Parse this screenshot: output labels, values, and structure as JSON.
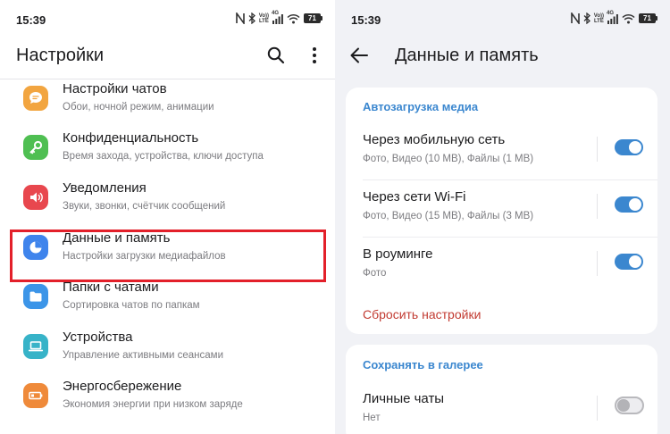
{
  "status_bar": {
    "time": "15:39",
    "network_label_top": "Vo))",
    "network_label_bottom": "LTE",
    "network_4g": "4G",
    "battery": "71"
  },
  "colors": {
    "accent": "#3b87cf",
    "highlight": "#e3202a",
    "reset_text": "#c23b32",
    "subtitle_text": "#7c7c80"
  },
  "left": {
    "title": "Настройки",
    "search_icon": "search-icon",
    "more_icon": "more-vertical-icon",
    "items": [
      {
        "title": "Настройки чатов",
        "subtitle": "Обои, ночной режим, анимации",
        "icon": "chat-bubble-icon",
        "color": "#f2a540"
      },
      {
        "title": "Конфиденциальность",
        "subtitle": "Время захода, устройства, ключи доступа",
        "icon": "key-icon",
        "color": "#4fbf52"
      },
      {
        "title": "Уведомления",
        "subtitle": "Звуки, звонки, счётчик сообщений",
        "icon": "speaker-icon",
        "color": "#e8474e"
      },
      {
        "title": "Данные и память",
        "subtitle": "Настройки загрузки медиафайлов",
        "icon": "pie-chart-icon",
        "color": "#3f84ec"
      },
      {
        "title": "Папки с чатами",
        "subtitle": "Сортировка чатов по папкам",
        "icon": "folder-icon",
        "color": "#3c95e8"
      },
      {
        "title": "Устройства",
        "subtitle": "Управление активными сеансами",
        "icon": "laptop-icon",
        "color": "#37b3c8"
      },
      {
        "title": "Энергосбережение",
        "subtitle": "Экономия энергии при низком заряде",
        "icon": "battery-icon",
        "color": "#ef8a3a"
      }
    ]
  },
  "right": {
    "title": "Данные и память",
    "back_icon": "back-arrow-icon",
    "autodownload": {
      "section_title": "Автозагрузка медиа",
      "rows": [
        {
          "title": "Через мобильную сеть",
          "subtitle": "Фото, Видео (10 MB), Файлы (1 MB)",
          "enabled": true
        },
        {
          "title": "Через сети Wi-Fi",
          "subtitle": "Фото, Видео (15 MB), Файлы (3 MB)",
          "enabled": true
        },
        {
          "title": "В роуминге",
          "subtitle": "Фото",
          "enabled": true
        }
      ],
      "reset_label": "Сбросить настройки"
    },
    "gallery": {
      "section_title": "Сохранять в галерее",
      "rows": [
        {
          "title": "Личные чаты",
          "subtitle": "Нет",
          "enabled": false
        }
      ]
    }
  }
}
